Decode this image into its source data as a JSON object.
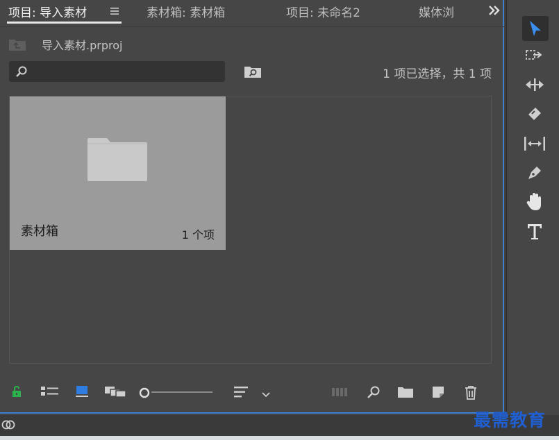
{
  "tabs": [
    {
      "label": "项目: 导入素材",
      "active": true
    },
    {
      "label": "素材箱: 素材箱",
      "active": false
    },
    {
      "label": "项目: 未命名2",
      "active": false
    },
    {
      "label": "媒体浏",
      "active": false
    }
  ],
  "project": {
    "file_name": "导入素材.prproj",
    "selection_status": "1 项已选择，共 1 项"
  },
  "bin": {
    "name": "素材箱",
    "count": "1 个项"
  },
  "watermark": "最需教育",
  "colors": {
    "accent_blue": "#3a7fd0",
    "tool_selected": "#3b8df0",
    "lock_green": "#2bb24c"
  }
}
